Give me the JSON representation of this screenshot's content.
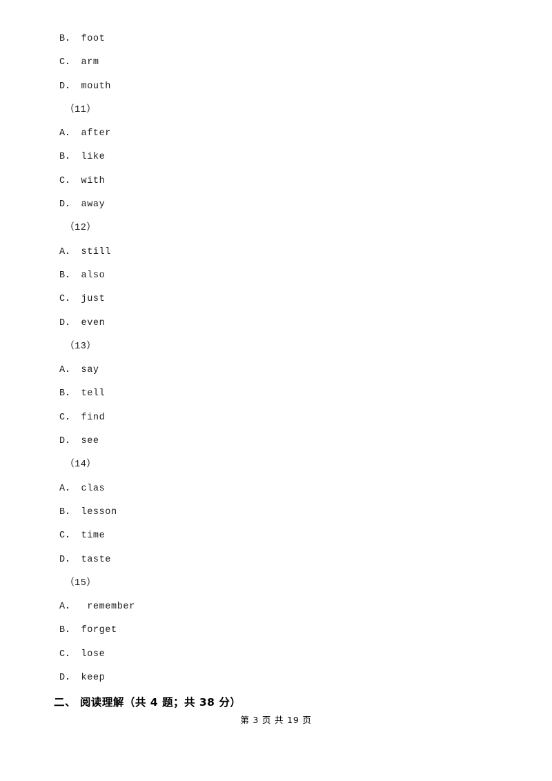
{
  "document": {
    "lines": [
      {
        "type": "option",
        "text": "B． foot"
      },
      {
        "type": "option",
        "text": "C． arm"
      },
      {
        "type": "option",
        "text": "D． mouth"
      },
      {
        "type": "qnum",
        "text": "（11）"
      },
      {
        "type": "option",
        "text": "A． after"
      },
      {
        "type": "option",
        "text": "B． like"
      },
      {
        "type": "option",
        "text": "C． with"
      },
      {
        "type": "option",
        "text": "D． away"
      },
      {
        "type": "qnum",
        "text": "（12）"
      },
      {
        "type": "option",
        "text": "A． still"
      },
      {
        "type": "option",
        "text": "B． also"
      },
      {
        "type": "option",
        "text": "C． just"
      },
      {
        "type": "option",
        "text": "D． even"
      },
      {
        "type": "qnum",
        "text": "（13）"
      },
      {
        "type": "option",
        "text": "A． say"
      },
      {
        "type": "option",
        "text": "B． tell"
      },
      {
        "type": "option",
        "text": "C． find"
      },
      {
        "type": "option",
        "text": "D． see"
      },
      {
        "type": "qnum",
        "text": "（14）"
      },
      {
        "type": "option",
        "text": "A． clas"
      },
      {
        "type": "option",
        "text": "B． lesson"
      },
      {
        "type": "option",
        "text": "C． time"
      },
      {
        "type": "option",
        "text": "D． taste"
      },
      {
        "type": "qnum",
        "text": "（15）"
      },
      {
        "type": "option",
        "text": "A．  remember"
      },
      {
        "type": "option",
        "text": "B． forget"
      },
      {
        "type": "option",
        "text": "C． lose"
      },
      {
        "type": "option",
        "text": "D． keep"
      }
    ],
    "section_heading": "二、 阅读理解（共 4 题；共 38 分）",
    "footer": "第 3 页 共 19 页"
  }
}
